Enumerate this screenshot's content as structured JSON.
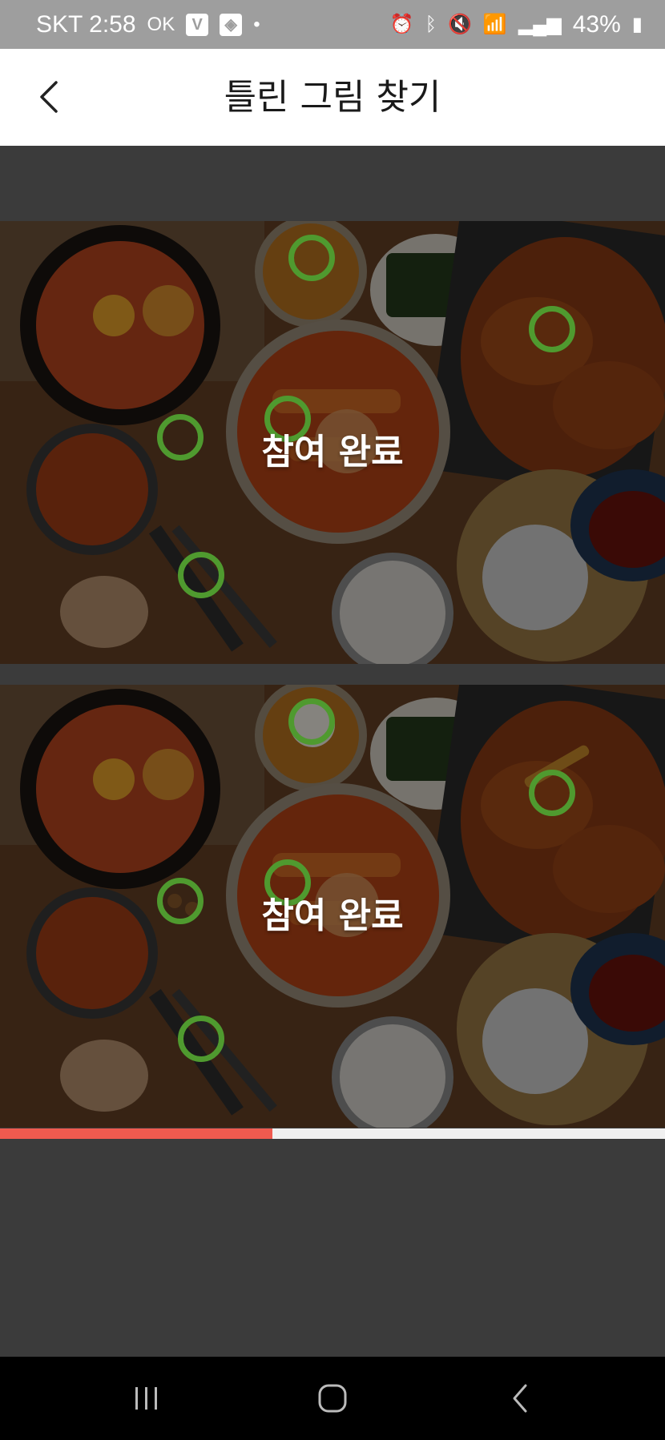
{
  "status_bar": {
    "carrier_time": "SKT 2:58",
    "ok_label": "OK",
    "dot": "•",
    "battery": "43%",
    "left_icons": [
      "ok-icon",
      "app-v-icon",
      "box-icon",
      "dot-icon"
    ],
    "right_icons": [
      "alarm-icon",
      "bluetooth-icon",
      "mute-icon",
      "wifi-icon",
      "signal-icon",
      "battery-icon"
    ]
  },
  "header": {
    "title": "틀린 그림 찾기",
    "back_icon": "chevron-left-icon"
  },
  "game": {
    "top_image": {
      "overlay": "참여 완료"
    },
    "bottom_image": {
      "overlay": "참여 완료"
    },
    "progress": 0.41,
    "found_marker_color": "#4f9a2f",
    "progress_color": "#f05a4f"
  },
  "nav_bar": {
    "icons": [
      "recent-apps-icon",
      "home-icon",
      "back-icon"
    ]
  }
}
